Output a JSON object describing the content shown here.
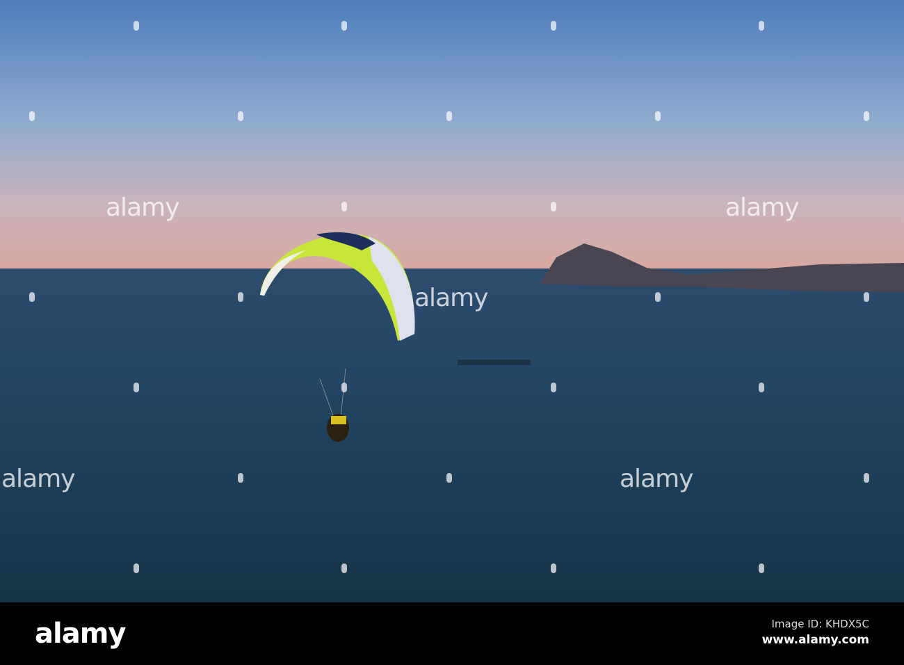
{
  "watermark": {
    "text": "alamy"
  },
  "footer": {
    "logo": "alamy",
    "image_id": "Image ID: KHDX5C",
    "site": "www.alamy.com"
  },
  "colors": {
    "sky_top": "#5a84bd",
    "sky_horizon": "#d6a9a3",
    "sea": "#1d3d55",
    "canopy": "#c8e63a"
  }
}
